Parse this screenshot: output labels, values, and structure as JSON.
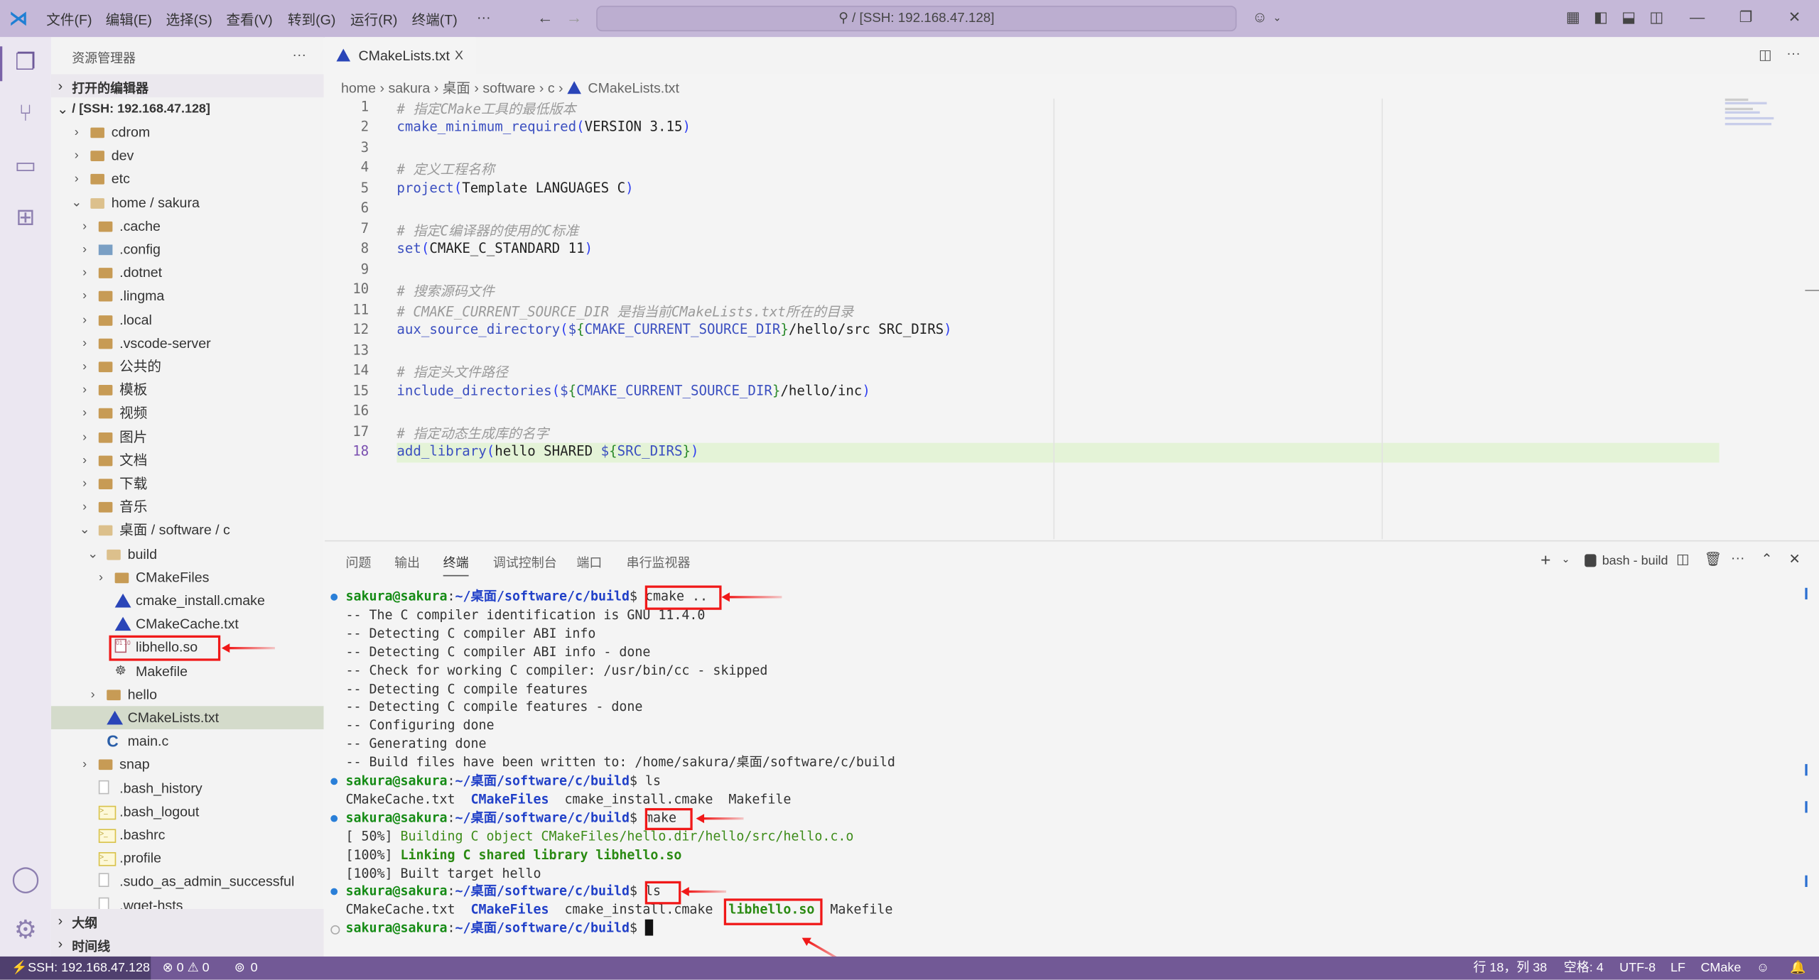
{
  "titlebar": {
    "menus": [
      "文件(F)",
      "编辑(E)",
      "选择(S)",
      "查看(V)",
      "转到(G)",
      "运行(R)",
      "终端(T)",
      "···"
    ],
    "search": "/ [SSH: 192.168.47.128]"
  },
  "sidebar": {
    "title": "资源管理器",
    "more": "···",
    "open_editors": "打开的编辑器",
    "root": "/ [SSH: 192.168.47.128]",
    "tree": [
      {
        "label": "cdrom",
        "level": 1,
        "kind": "folder",
        "chev": "›"
      },
      {
        "label": "dev",
        "level": 1,
        "kind": "folder",
        "chev": "›"
      },
      {
        "label": "etc",
        "level": 1,
        "kind": "folder",
        "chev": "›"
      },
      {
        "label": "home / sakura",
        "level": 1,
        "kind": "folder-open",
        "chev": "⌄"
      },
      {
        "label": ".cache",
        "level": 2,
        "kind": "folder",
        "chev": "›"
      },
      {
        "label": ".config",
        "level": 2,
        "kind": "config",
        "chev": "›"
      },
      {
        "label": ".dotnet",
        "level": 2,
        "kind": "folder",
        "chev": "›"
      },
      {
        "label": ".lingma",
        "level": 2,
        "kind": "folder",
        "chev": "›"
      },
      {
        "label": ".local",
        "level": 2,
        "kind": "folder",
        "chev": "›"
      },
      {
        "label": ".vscode-server",
        "level": 2,
        "kind": "folder",
        "chev": "›"
      },
      {
        "label": "公共的",
        "level": 2,
        "kind": "folder",
        "chev": "›"
      },
      {
        "label": "模板",
        "level": 2,
        "kind": "folder",
        "chev": "›"
      },
      {
        "label": "视频",
        "level": 2,
        "kind": "folder",
        "chev": "›"
      },
      {
        "label": "图片",
        "level": 2,
        "kind": "folder",
        "chev": "›"
      },
      {
        "label": "文档",
        "level": 2,
        "kind": "folder",
        "chev": "›"
      },
      {
        "label": "下载",
        "level": 2,
        "kind": "folder",
        "chev": "›"
      },
      {
        "label": "音乐",
        "level": 2,
        "kind": "folder",
        "chev": "›"
      },
      {
        "label": "桌面 / software / c",
        "level": 2,
        "kind": "folder-open",
        "chev": "⌄"
      },
      {
        "label": "build",
        "level": 3,
        "kind": "folder-open",
        "chev": "⌄"
      },
      {
        "label": "CMakeFiles",
        "level": 4,
        "kind": "folder",
        "chev": "›"
      },
      {
        "label": "cmake_install.cmake",
        "level": 4,
        "kind": "cmake",
        "chev": ""
      },
      {
        "label": "CMakeCache.txt",
        "level": 4,
        "kind": "cmake",
        "chev": ""
      },
      {
        "label": "libhello.so",
        "level": 4,
        "kind": "binary",
        "chev": ""
      },
      {
        "label": "Makefile",
        "level": 4,
        "kind": "makefile",
        "chev": ""
      },
      {
        "label": "hello",
        "level": 3,
        "kind": "folder",
        "chev": "›"
      },
      {
        "label": "CMakeLists.txt",
        "level": 3,
        "kind": "cmake",
        "chev": "",
        "selected": true
      },
      {
        "label": "main.c",
        "level": 3,
        "kind": "c",
        "chev": ""
      },
      {
        "label": "snap",
        "level": 2,
        "kind": "folder",
        "chev": "›"
      },
      {
        "label": ".bash_history",
        "level": 2,
        "kind": "plain",
        "chev": ""
      },
      {
        "label": ".bash_logout",
        "level": 2,
        "kind": "shell",
        "chev": ""
      },
      {
        "label": ".bashrc",
        "level": 2,
        "kind": "shell",
        "chev": ""
      },
      {
        "label": ".profile",
        "level": 2,
        "kind": "shell",
        "chev": ""
      },
      {
        "label": ".sudo_as_admin_successful",
        "level": 2,
        "kind": "plain",
        "chev": ""
      },
      {
        "label": ".wget-hsts",
        "level": 2,
        "kind": "plain",
        "chev": ""
      }
    ],
    "outline": "大纲",
    "timeline": "时间线"
  },
  "editor": {
    "tab": "CMakeLists.txt",
    "tab_close": "X",
    "breadcrumb": [
      "home",
      "sakura",
      "桌面",
      "software",
      "c",
      "CMakeLists.txt"
    ],
    "current_line": 18,
    "lines": [
      [
        [
          "cm",
          "# 指定CMake工具的最低版本"
        ]
      ],
      [
        [
          "fn",
          "cmake_minimum_required"
        ],
        [
          "par",
          "("
        ],
        [
          "tx",
          "VERSION 3.15"
        ],
        [
          "par",
          ")"
        ]
      ],
      [],
      [
        [
          "cm",
          "# 定义工程名称"
        ]
      ],
      [
        [
          "fn",
          "project"
        ],
        [
          "par",
          "("
        ],
        [
          "tx",
          "Template LANGUAGES C"
        ],
        [
          "par",
          ")"
        ]
      ],
      [],
      [
        [
          "cm",
          "# 指定C编译器的使用的C标准"
        ]
      ],
      [
        [
          "fn",
          "set"
        ],
        [
          "par",
          "("
        ],
        [
          "tx",
          "CMAKE_C_STANDARD 11"
        ],
        [
          "par",
          ")"
        ]
      ],
      [],
      [
        [
          "cm",
          "# 搜索源码文件"
        ]
      ],
      [
        [
          "cm",
          "# CMAKE_CURRENT_SOURCE_DIR 是指当前CMakeLists.txt所在的目录"
        ]
      ],
      [
        [
          "fn",
          "aux_source_directory"
        ],
        [
          "par",
          "("
        ],
        [
          "vr",
          "$"
        ],
        [
          "br",
          "{"
        ],
        [
          "vr",
          "CMAKE_CURRENT_SOURCE_DIR"
        ],
        [
          "br",
          "}"
        ],
        [
          "tx",
          "/hello/src SRC_DIRS"
        ],
        [
          "par",
          ")"
        ]
      ],
      [],
      [
        [
          "cm",
          "# 指定头文件路径"
        ]
      ],
      [
        [
          "fn",
          "include_directories"
        ],
        [
          "par",
          "("
        ],
        [
          "vr",
          "$"
        ],
        [
          "br",
          "{"
        ],
        [
          "vr",
          "CMAKE_CURRENT_SOURCE_DIR"
        ],
        [
          "br",
          "}"
        ],
        [
          "tx",
          "/hello/inc"
        ],
        [
          "par",
          ")"
        ]
      ],
      [],
      [
        [
          "cm",
          "# 指定动态生成库的名字"
        ]
      ],
      [
        [
          "fn",
          "add_library"
        ],
        [
          "par",
          "("
        ],
        [
          "tx",
          "hello SHARED "
        ],
        [
          "vr",
          "$"
        ],
        [
          "br",
          "{"
        ],
        [
          "vr",
          "SRC_DIRS"
        ],
        [
          "br",
          "}"
        ],
        [
          "par",
          ")"
        ]
      ]
    ]
  },
  "panel": {
    "tabs": [
      "问题",
      "输出",
      "终端",
      "调试控制台",
      "端口",
      "串行监视器"
    ],
    "active_tab": "终端",
    "terminal_name": "bash - build",
    "lines": [
      {
        "dot": "filled",
        "segs": [
          [
            "pg",
            "sakura@sakura"
          ],
          [
            "o",
            ":"
          ],
          [
            "pb",
            "~/桌面/software/c/build"
          ],
          [
            "o",
            "$ cmake .."
          ]
        ]
      },
      {
        "segs": [
          [
            "o",
            "-- The C compiler identification is GNU 11.4.0"
          ]
        ]
      },
      {
        "segs": [
          [
            "o",
            "-- Detecting C compiler ABI info"
          ]
        ]
      },
      {
        "segs": [
          [
            "o",
            "-- Detecting C compiler ABI info - done"
          ]
        ]
      },
      {
        "segs": [
          [
            "o",
            "-- Check for working C compiler: /usr/bin/cc - skipped"
          ]
        ]
      },
      {
        "segs": [
          [
            "o",
            "-- Detecting C compile features"
          ]
        ]
      },
      {
        "segs": [
          [
            "o",
            "-- Detecting C compile features - done"
          ]
        ]
      },
      {
        "segs": [
          [
            "o",
            "-- Configuring done"
          ]
        ]
      },
      {
        "segs": [
          [
            "o",
            "-- Generating done"
          ]
        ]
      },
      {
        "segs": [
          [
            "o",
            "-- Build files have been written to: /home/sakura/桌面/software/c/build"
          ]
        ]
      },
      {
        "dot": "filled",
        "segs": [
          [
            "pg",
            "sakura@sakura"
          ],
          [
            "o",
            ":"
          ],
          [
            "pb",
            "~/桌面/software/c/build"
          ],
          [
            "o",
            "$ ls"
          ]
        ]
      },
      {
        "segs": [
          [
            "o",
            "CMakeCache.txt  "
          ],
          [
            "db",
            "CMakeFiles"
          ],
          [
            "o",
            "  cmake_install.cmake  Makefile"
          ]
        ]
      },
      {
        "dot": "filled",
        "segs": [
          [
            "pg",
            "sakura@sakura"
          ],
          [
            "o",
            ":"
          ],
          [
            "pb",
            "~/桌面/software/c/build"
          ],
          [
            "o",
            "$ make"
          ]
        ]
      },
      {
        "segs": [
          [
            "o",
            "[ 50%] "
          ],
          [
            "gr",
            "Building C object CMakeFiles/hello.dir/hello/src/hello.c.o"
          ]
        ]
      },
      {
        "segs": [
          [
            "o",
            "[100%] "
          ],
          [
            "gb",
            "Linking C shared library libhello.so"
          ]
        ]
      },
      {
        "segs": [
          [
            "o",
            "[100%] Built target hello"
          ]
        ]
      },
      {
        "dot": "filled",
        "segs": [
          [
            "pg",
            "sakura@sakura"
          ],
          [
            "o",
            ":"
          ],
          [
            "pb",
            "~/桌面/software/c/build"
          ],
          [
            "o",
            "$ ls"
          ]
        ]
      },
      {
        "segs": [
          [
            "o",
            "CMakeCache.txt  "
          ],
          [
            "db",
            "CMakeFiles"
          ],
          [
            "o",
            "  cmake_install.cmake  "
          ],
          [
            "gb",
            "libhello.so"
          ],
          [
            "o",
            "  Makefile"
          ]
        ]
      },
      {
        "dot": "empty",
        "segs": [
          [
            "pg",
            "sakura@sakura"
          ],
          [
            "o",
            ":"
          ],
          [
            "pb",
            "~/桌面/software/c/build"
          ],
          [
            "o",
            "$ "
          ]
        ]
      }
    ]
  },
  "status": {
    "remote": "SSH: 192.168.47.128",
    "problems": "⊗ 0 ⚠ 0",
    "ports": "0",
    "position": "行 18，列 38",
    "spaces": "空格: 4",
    "encoding": "UTF-8",
    "eol": "LF",
    "language": "CMake"
  },
  "colors": {
    "titlebar": "#c5b8d8",
    "statusbar": "#725996",
    "remote": "#4f3f6e",
    "annotation": "#f01818",
    "current_line": "#e4f3d7"
  }
}
